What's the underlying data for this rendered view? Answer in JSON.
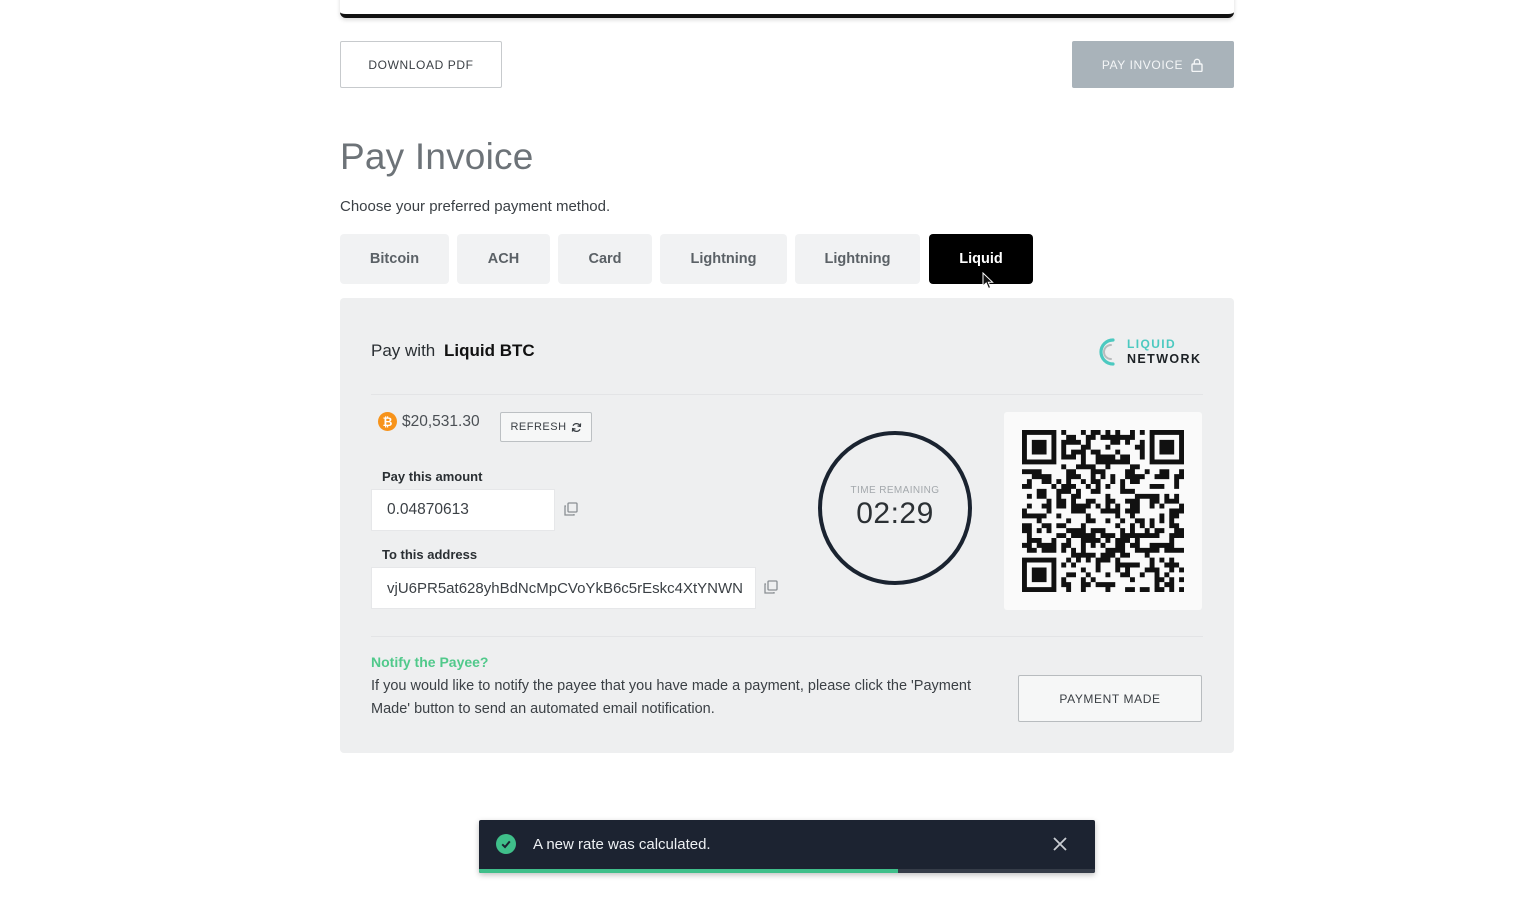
{
  "header": {
    "download_label": "DOWNLOAD PDF",
    "pay_invoice_label": "PAY INVOICE"
  },
  "page": {
    "title": "Pay Invoice",
    "subtitle": "Choose your preferred payment method."
  },
  "tabs": [
    {
      "label": "Bitcoin",
      "active": false
    },
    {
      "label": "ACH",
      "active": false
    },
    {
      "label": "Card",
      "active": false
    },
    {
      "label": "Lightning",
      "active": false
    },
    {
      "label": "Lightning",
      "active": false
    },
    {
      "label": "Liquid",
      "active": true
    }
  ],
  "panel": {
    "pay_with_prefix": "Pay with",
    "pay_with_method": "Liquid BTC",
    "logo_top": "LIQUID",
    "logo_bottom": "NETWORK",
    "rate": "$20,531.30",
    "refresh_label": "REFRESH",
    "amount_label": "Pay this amount",
    "amount_value": "0.04870613",
    "address_label": "To this address",
    "address_value": "vjU6PR5at628yhBdNcMpCVoYkB6c5rEskc4XtYNWN",
    "timer_label": "TIME REMAINING",
    "timer_value": "02:29",
    "notify_title": "Notify the Payee?",
    "notify_text": "If you would like to notify the payee that you have made a payment, please click the 'Payment Made' button to send an automated email notification.",
    "payment_made_label": "PAYMENT MADE"
  },
  "toast": {
    "message": "A new rate was calculated.",
    "progress": 0.68
  },
  "colors": {
    "accent_green": "#51c98b",
    "liquid_teal": "#4cc9c0",
    "bitcoin_orange": "#f7931a",
    "active_tab": "#000000",
    "toast_bg": "#1c2331"
  },
  "icons": [
    "lock-icon",
    "bitcoin-icon",
    "refresh-icon",
    "copy-icon",
    "liquid-logo-icon",
    "qr-code",
    "check-circle-icon",
    "close-icon",
    "cursor-icon"
  ]
}
